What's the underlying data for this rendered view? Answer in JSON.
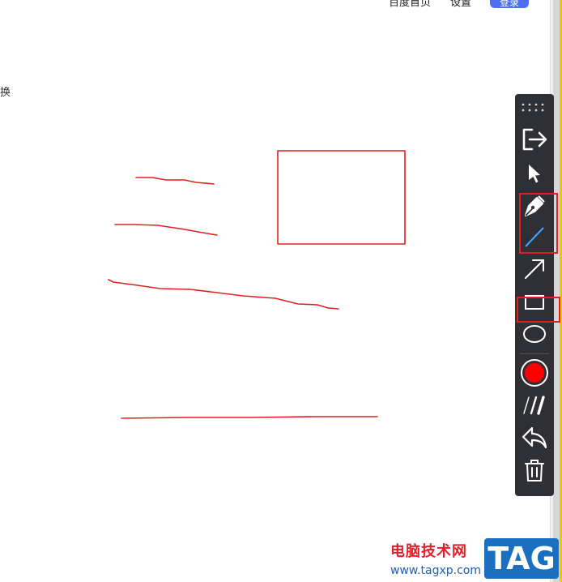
{
  "header": {
    "link_home": "百度首页",
    "link_settings": "设置",
    "login_label": "登录"
  },
  "side": {
    "partial_text": "换"
  },
  "annotation_colors": {
    "stroke": "#e02020",
    "line_tool": "#3fa6ff"
  },
  "toolbar": {
    "tools": [
      {
        "name": "drag-handle-icon"
      },
      {
        "name": "exit-icon"
      },
      {
        "name": "pointer-icon"
      },
      {
        "name": "pen-icon"
      },
      {
        "name": "line-icon"
      },
      {
        "name": "arrow-icon"
      },
      {
        "name": "rectangle-icon"
      },
      {
        "name": "ellipse-icon"
      },
      {
        "name": "color-swatch-icon",
        "color": "#ff0000"
      },
      {
        "name": "stroke-width-icon"
      },
      {
        "name": "undo-icon"
      },
      {
        "name": "trash-icon"
      }
    ]
  },
  "watermark": {
    "site_name": "电脑技术网",
    "url": "www.tagxp.com",
    "tag": "TAG"
  }
}
